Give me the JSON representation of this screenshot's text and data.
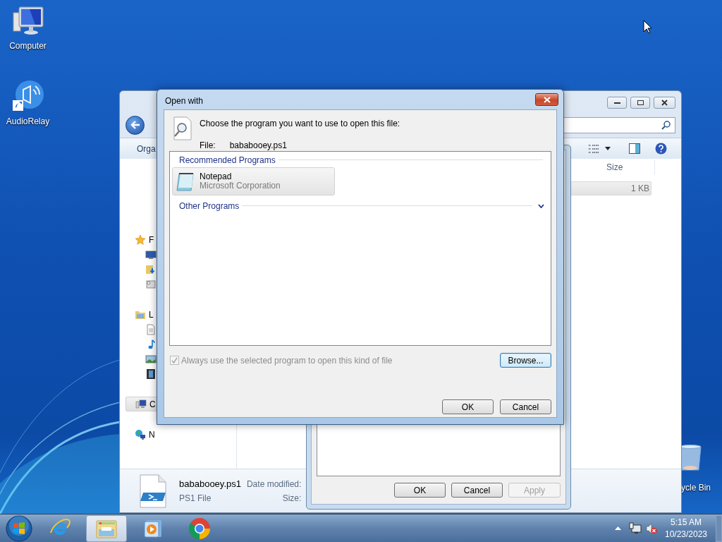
{
  "desktop_icons": [
    {
      "kind": "computer",
      "label": "Computer"
    },
    {
      "kind": "audiorelay",
      "label": "AudioRelay"
    },
    {
      "kind": "recycle-bin",
      "label": "ycle Bin"
    }
  ],
  "explorer": {
    "toolbar_label": "Orga",
    "nav": [
      {
        "kind": "star",
        "label": "F",
        "selected": false,
        "children": [
          {
            "kind": "desktop",
            "selected": false
          },
          {
            "kind": "downloads",
            "selected": false
          },
          {
            "kind": "recent",
            "selected": false
          }
        ]
      },
      {
        "kind": "library",
        "label": "L",
        "selected": false,
        "children": [
          {
            "kind": "documents",
            "selected": false
          },
          {
            "kind": "music",
            "selected": false
          },
          {
            "kind": "pictures",
            "selected": false
          },
          {
            "kind": "videos",
            "selected": false
          }
        ]
      },
      {
        "kind": "computer",
        "label": "C",
        "selected": true
      },
      {
        "kind": "network",
        "label": "N",
        "selected": false
      }
    ],
    "column": "Size",
    "row": {
      "size": "1 KB",
      "selected": true
    },
    "details": {
      "name": "bababooey.ps1",
      "type": "PS1 File",
      "date_label": "Date modified:",
      "size_label": "Size:"
    }
  },
  "properties": {
    "buttons": [
      {
        "label": "OK",
        "disabled": false
      },
      {
        "label": "Cancel",
        "disabled": false
      },
      {
        "label": "Apply",
        "disabled": true
      }
    ]
  },
  "open_with": {
    "title": "Open with",
    "prompt": "Choose the program you want to use to open this file:",
    "file_label": "File:",
    "file_name": "bababooey.ps1",
    "recommended": {
      "title": "Recommended Programs",
      "programs": [
        {
          "name": "Notepad",
          "publisher": "Microsoft Corporation",
          "selected": true
        }
      ]
    },
    "other": {
      "title": "Other Programs",
      "expanded": false
    },
    "always_use": {
      "label": "Always use the selected program to open this kind of file",
      "checked": true,
      "disabled": true
    },
    "browse": "Browse...",
    "ok": "OK",
    "cancel": "Cancel"
  },
  "taskbar": {
    "apps": [
      {
        "kind": "ie",
        "active": false
      },
      {
        "kind": "explorer",
        "active": true
      },
      {
        "kind": "media",
        "active": false
      },
      {
        "kind": "chrome",
        "active": false
      }
    ],
    "clock": {
      "time": "5:15 AM",
      "date": "10/23/2023"
    }
  }
}
